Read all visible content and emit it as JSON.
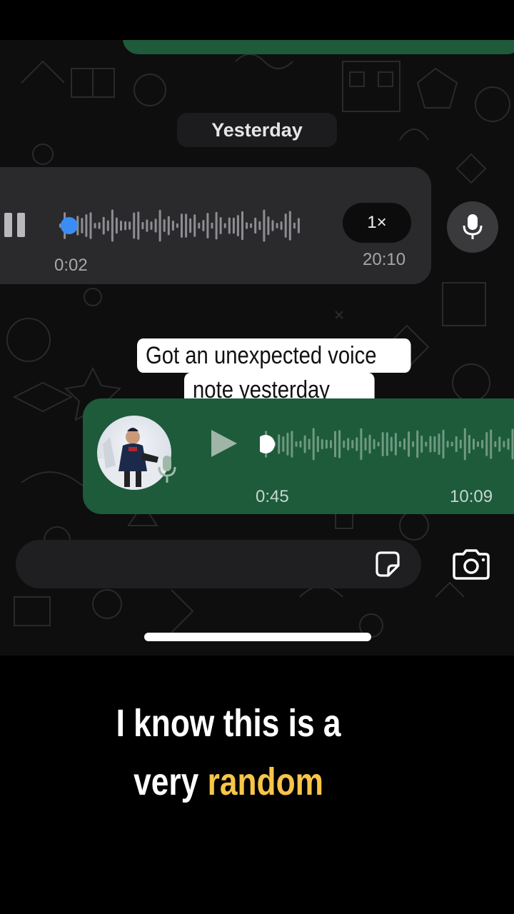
{
  "chat": {
    "date_separator": "Yesterday",
    "incoming_voice": {
      "duration": "0:02",
      "timestamp": "20:10",
      "speed": "1×",
      "state": "playing",
      "progress": 0.02
    },
    "outgoing_voice": {
      "duration": "0:45",
      "timestamp": "10:09",
      "state": "paused",
      "progress": 0.0
    }
  },
  "caption": {
    "line1": "Got an unexpected voice",
    "line2": "note yesterday"
  },
  "subtitle": {
    "line1": "I know this is a",
    "line2_plain": "very",
    "line2_highlight": "random"
  },
  "icons": {
    "pause": "pause-icon",
    "mic": "microphone-icon",
    "play": "play-icon",
    "sticker": "sticker-icon",
    "camera": "camera-icon"
  },
  "colors": {
    "outgoing_bubble": "#1d5b3b",
    "incoming_bubble": "#2a2a2d",
    "playhead_blue": "#3b8cf5",
    "subtitle_highlight": "#f7c548"
  }
}
